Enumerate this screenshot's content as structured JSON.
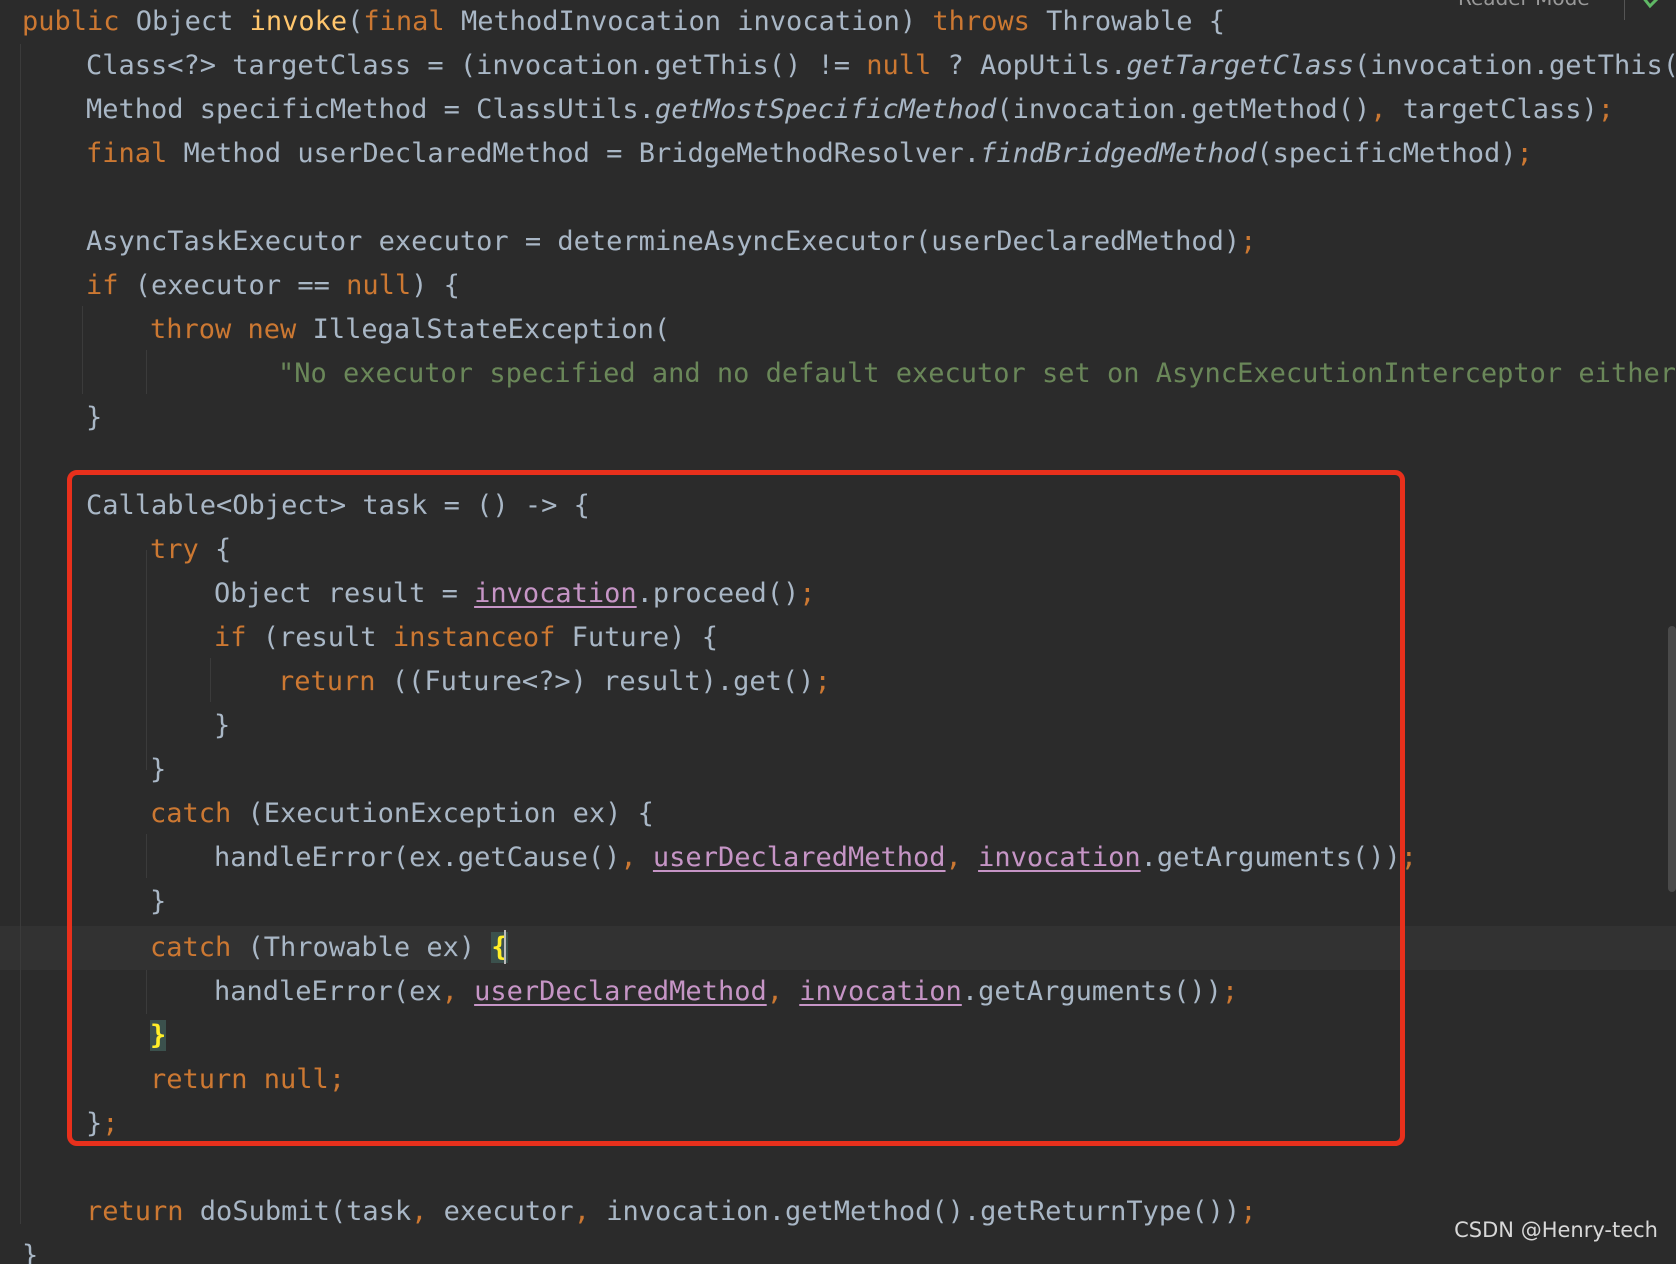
{
  "editor": {
    "reader_mode_label": "Reader Mode",
    "watermark": "CSDN @Henry-tech"
  },
  "code": {
    "l1": {
      "kw1": "public ",
      "t1": "Object ",
      "fn": "invoke",
      "t2": "(",
      "kw2": "final ",
      "t3": "MethodInvocation invocation) ",
      "kw3": "throws ",
      "t4": "Throwable {"
    },
    "l2": {
      "t1": "Class<?> targetClass = (invocation.getThis() != ",
      "kw1": "null",
      "t2": " ? AopUtils.",
      "it1": "getTargetClass",
      "t3": "(invocation.getThis()"
    },
    "l3": {
      "t1": "Method specificMethod = ClassUtils.",
      "it1": "getMostSpecificMethod",
      "t2": "(invocation.getMethod()",
      "s1": ",",
      "t3": " targetClass)",
      "s2": ";"
    },
    "l4": {
      "kw1": "final ",
      "t1": "Method userDeclaredMethod = BridgeMethodResolver.",
      "it1": "findBridgedMethod",
      "t2": "(specificMethod)",
      "s1": ";"
    },
    "l6": {
      "t1": "AsyncTaskExecutor executor = determineAsyncExecutor(userDeclaredMethod)",
      "s1": ";"
    },
    "l7": {
      "kw1": "if",
      "t1": " (executor == ",
      "kw2": "null",
      "t2": ") {"
    },
    "l8": {
      "kw1": "throw new ",
      "t1": "IllegalStateException("
    },
    "l9": {
      "str": "\"No executor specified and no default executor set on AsyncExecutionInterceptor either\")"
    },
    "l10": {
      "t1": "}"
    },
    "l12": {
      "t1": "Callable<Object> task = () -> {"
    },
    "l13": {
      "kw1": "try",
      "t1": " {"
    },
    "l14": {
      "t1": "Object result = ",
      "ul1": "invocation",
      "t2": ".proceed()",
      "s1": ";"
    },
    "l15": {
      "kw1": "if",
      "t1": " (result ",
      "kw2": "instanceof",
      "t2": " Future) {"
    },
    "l16": {
      "kw1": "return",
      "t1": " ((Future<?>) result).get()",
      "s1": ";"
    },
    "l17": {
      "t1": "}"
    },
    "l18": {
      "t1": "}"
    },
    "l19": {
      "kw1": "catch",
      "t1": " (ExecutionException ex) {"
    },
    "l20": {
      "t1": "handleError(ex.getCause()",
      "s1": ",",
      "sp1": " ",
      "ul1": "userDeclaredMethod",
      "s2": ",",
      "sp2": " ",
      "ul2": "invocation",
      "t2": ".getArguments())",
      "s3": ";"
    },
    "l21": {
      "t1": "}"
    },
    "l22": {
      "kw1": "catch",
      "t1": " (Throwable ex) ",
      "br": "{"
    },
    "l23": {
      "t1": "handleError(ex",
      "s1": ",",
      "sp1": " ",
      "ul1": "userDeclaredMethod",
      "s2": ",",
      "sp2": " ",
      "ul2": "invocation",
      "t2": ".getArguments())",
      "s3": ";"
    },
    "l24": {
      "br": "}"
    },
    "l25": {
      "kw1": "return null",
      "s1": ";"
    },
    "l26": {
      "t1": "}",
      "s1": ";"
    },
    "l28": {
      "kw1": "return",
      "t1": " doSubmit(task",
      "s1": ",",
      "t2": " executor",
      "s2": ",",
      "t3": " invocation.getMethod().getReturnType())",
      "s3": ";"
    },
    "l29": {
      "t1": "}"
    }
  }
}
